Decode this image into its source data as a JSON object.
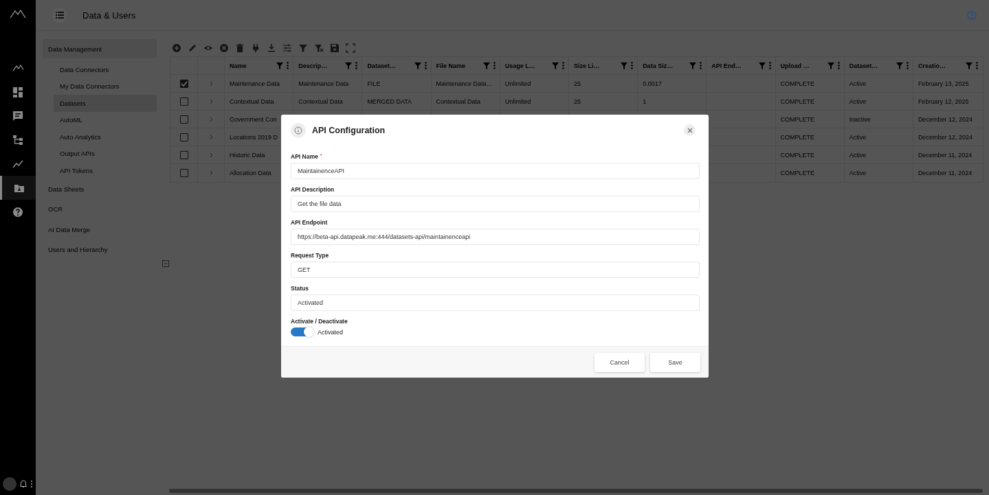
{
  "header": {
    "title": "Data & Users"
  },
  "rail": {
    "items": [
      {
        "selected": false
      },
      {
        "selected": false
      },
      {
        "selected": false
      },
      {
        "selected": false
      },
      {
        "selected": false
      },
      {
        "selected": true
      },
      {
        "selected": false
      }
    ]
  },
  "sidebar": {
    "groups": [
      {
        "label": "Data Management",
        "expanded": true,
        "children": [
          {
            "label": "Data Connectors",
            "selected": false
          },
          {
            "label": "My Data Connectors",
            "selected": false
          },
          {
            "label": "Datasets",
            "selected": true
          },
          {
            "label": "AutoML",
            "selected": false
          },
          {
            "label": "Auto Analytics",
            "selected": false
          },
          {
            "label": "Output APIs",
            "selected": false
          },
          {
            "label": "API Tokens",
            "selected": false
          }
        ]
      },
      {
        "label": "Data Sheets",
        "expanded": false
      },
      {
        "label": "OCR",
        "expanded": false
      },
      {
        "label": "AI Data Merge",
        "expanded": false
      },
      {
        "label": "Users and Hierarchy",
        "expanded": false
      }
    ]
  },
  "table": {
    "columns": [
      "Name",
      "Descrip…",
      "Dataset…",
      "File Name",
      "Usage L…",
      "Size Li…",
      "Data Siz…",
      "API End…",
      "Upload …",
      "Dataset…",
      "Creatio…"
    ],
    "rows": [
      {
        "selected": true,
        "cells": [
          "Maintenance Data",
          "Maintenance Data",
          "FILE",
          "Maintenance Data…",
          "Unlimited",
          "25",
          "0.0017",
          null,
          "COMPLETE",
          "Active",
          "February 13, 2025"
        ]
      },
      {
        "selected": false,
        "cells": [
          "Contextual Data",
          "Contextual Data",
          "MERGED DATA",
          "Contextual Data",
          "Unlimited",
          "25",
          "1",
          null,
          "COMPLETE",
          "Active",
          "February 12, 2025"
        ]
      },
      {
        "selected": false,
        "cells": [
          "Government Con",
          null,
          null,
          null,
          null,
          null,
          null,
          null,
          "COMPLETE",
          "Inactive",
          "December 12, 2024"
        ]
      },
      {
        "selected": false,
        "cells": [
          "Locations 2019 D",
          null,
          null,
          null,
          null,
          null,
          null,
          null,
          "COMPLETE",
          "Active",
          "December 12, 2024"
        ]
      },
      {
        "selected": false,
        "cells": [
          "Historic Data",
          null,
          null,
          null,
          null,
          null,
          null,
          null,
          "COMPLETE",
          "Active",
          "December 11, 2024"
        ]
      },
      {
        "selected": false,
        "cells": [
          "Allocation Data",
          null,
          null,
          null,
          null,
          null,
          null,
          null,
          "COMPLETE",
          "Active",
          "December 11, 2024"
        ]
      }
    ]
  },
  "dialog": {
    "title": "API Configuration",
    "fields": [
      {
        "label": "API Name",
        "required_mark": "*",
        "value": "MaintainenceAPI"
      },
      {
        "label": "API Description",
        "value": "Get the file data"
      },
      {
        "label": "API Endpoint",
        "value": "https://beta-api.datapeak.me:444/datasets-api/maintainenceapi"
      },
      {
        "label": "Request Type",
        "value": "GET"
      },
      {
        "label": "Status",
        "value": "Activated"
      }
    ],
    "toggle": {
      "label": "Activate / Deactivate",
      "on": true,
      "text": "Activated"
    },
    "buttons": [
      "Cancel",
      "Save"
    ]
  }
}
